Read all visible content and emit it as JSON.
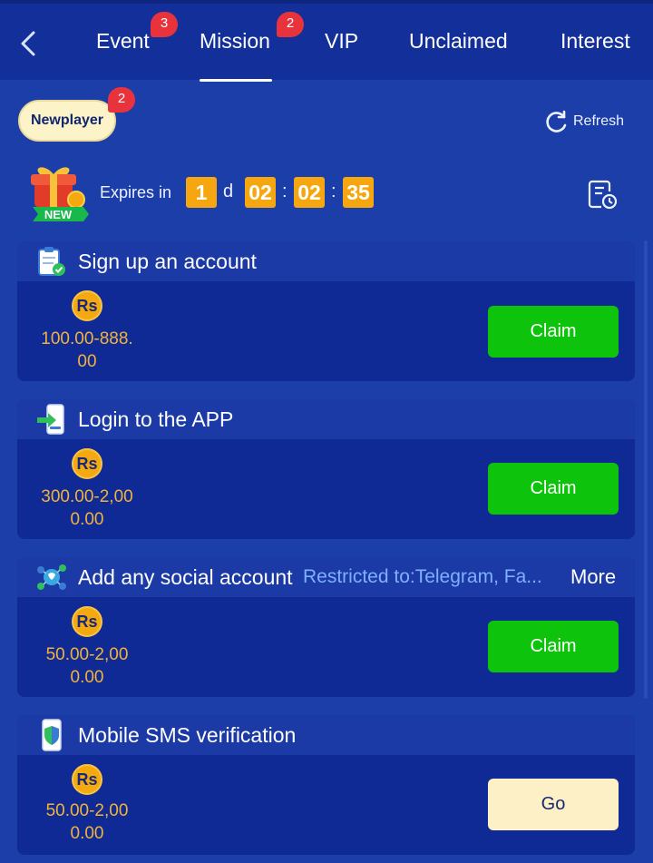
{
  "nav": {
    "tabs": [
      {
        "label": "Event",
        "badge": "3"
      },
      {
        "label": "Mission",
        "badge": "2"
      },
      {
        "label": "VIP"
      },
      {
        "label": "Unclaimed"
      },
      {
        "label": "Interest"
      }
    ],
    "active_tab": "Mission"
  },
  "filter": {
    "chip_label": "Newplayer",
    "chip_badge": "2",
    "refresh_label": "Refresh"
  },
  "countdown": {
    "expires_label": "Expires in",
    "days": "1",
    "day_unit": "d",
    "hours": "02",
    "minutes": "02",
    "seconds": "35",
    "separator": ":"
  },
  "gift_badge_text": "NEW",
  "currency_symbol": "Rs",
  "missions": [
    {
      "title": "Sign up an account",
      "amount_line1": "100.00-888.",
      "amount_line2": "00",
      "button": "Claim",
      "icon": "clipboard-check-icon"
    },
    {
      "title": "Login to the APP",
      "amount_line1": "300.00-2,00",
      "amount_line2": "0.00",
      "button": "Claim",
      "icon": "phone-login-icon"
    },
    {
      "title": "Add any social account",
      "restriction": "Restricted to:Telegram, Fa...",
      "more": "More",
      "amount_line1": "50.00-2,00",
      "amount_line2": "0.00",
      "button": "Claim",
      "icon": "social-network-icon"
    },
    {
      "title": "Mobile SMS verification",
      "amount_line1": "50.00-2,00",
      "amount_line2": "0.00",
      "button": "Go",
      "icon": "phone-shield-icon"
    }
  ],
  "colors": {
    "background": "#1b3ea8",
    "card": "#0f2a94",
    "claim_button": "#0ec30b",
    "go_button": "#fdf0c6",
    "timer": "#f6a60e",
    "amount": "#f2b33a",
    "badge": "#e8323c"
  }
}
